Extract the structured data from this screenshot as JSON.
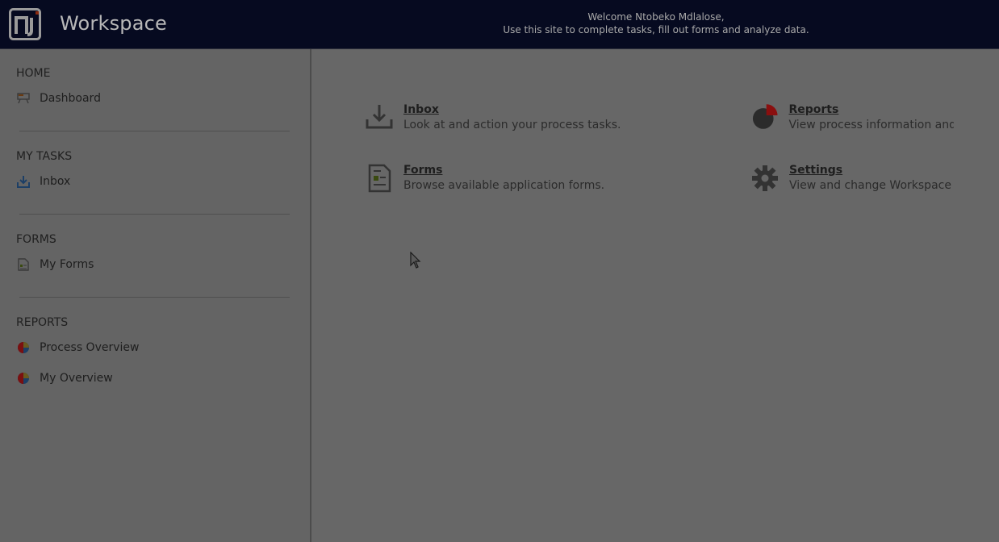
{
  "header": {
    "logo_text": "n",
    "brand": "Workspace",
    "welcome_line1": "Welcome Ntobeko Mdlalose,",
    "welcome_line2": "Use this site to complete tasks, fill out forms and analyze data."
  },
  "sidebar": {
    "sections": [
      {
        "title": "HOME",
        "items": [
          {
            "label": "Dashboard",
            "icon": "dashboard-icon"
          }
        ]
      },
      {
        "title": "MY TASKS",
        "items": [
          {
            "label": "Inbox",
            "icon": "inbox-download-icon"
          }
        ]
      },
      {
        "title": "FORMS",
        "items": [
          {
            "label": "My Forms",
            "icon": "form-document-icon"
          }
        ]
      },
      {
        "title": "REPORTS",
        "items": [
          {
            "label": "Process Overview",
            "icon": "pie-chart-icon"
          },
          {
            "label": "My Overview",
            "icon": "pie-chart-icon"
          }
        ]
      }
    ]
  },
  "tiles": {
    "inbox": {
      "title": "Inbox",
      "desc": "Look at and action your process tasks.",
      "icon": "inbox-download-icon"
    },
    "reports": {
      "title": "Reports",
      "desc": "View process information and",
      "icon": "pie-chart-icon"
    },
    "forms": {
      "title": "Forms",
      "desc": "Browse available application forms.",
      "icon": "form-document-icon"
    },
    "settings": {
      "title": "Settings",
      "desc": "View and change Workspace",
      "icon": "gear-icon"
    }
  },
  "colors": {
    "header_bg": "#060a20",
    "page_overlay": "#676767",
    "accent_red": "#7a1010",
    "accent_blue": "#1d3f66"
  }
}
